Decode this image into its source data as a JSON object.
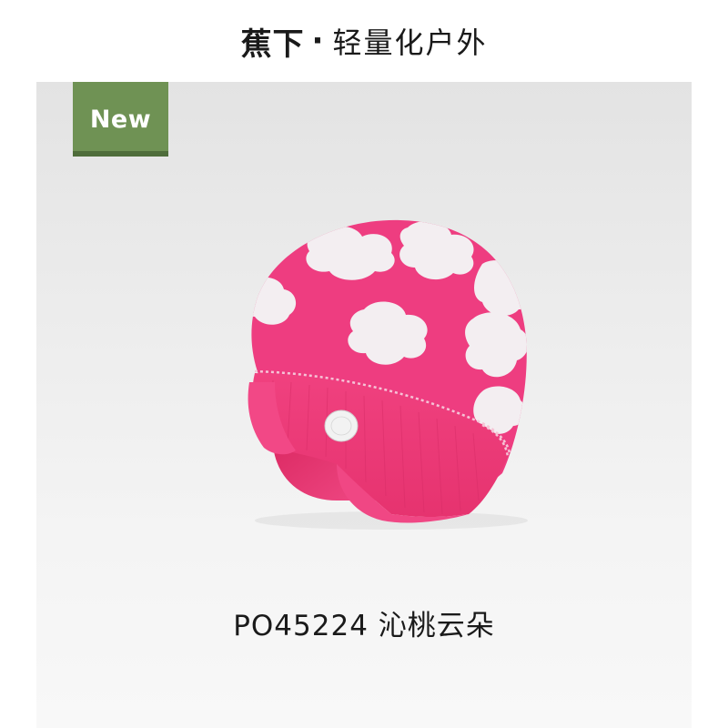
{
  "header": {
    "brand": "蕉下",
    "separator": "·",
    "slogan": "轻量化户外"
  },
  "badge": {
    "label": "New",
    "color": "#6f9254"
  },
  "product": {
    "code": "PO45224",
    "name": "沁桃云朵",
    "image": "pink-cloud-knit-beanie-with-ear-flaps",
    "colors": {
      "knit_pink": "#ef3f82",
      "cloud_white": "#f3f0f2"
    }
  }
}
